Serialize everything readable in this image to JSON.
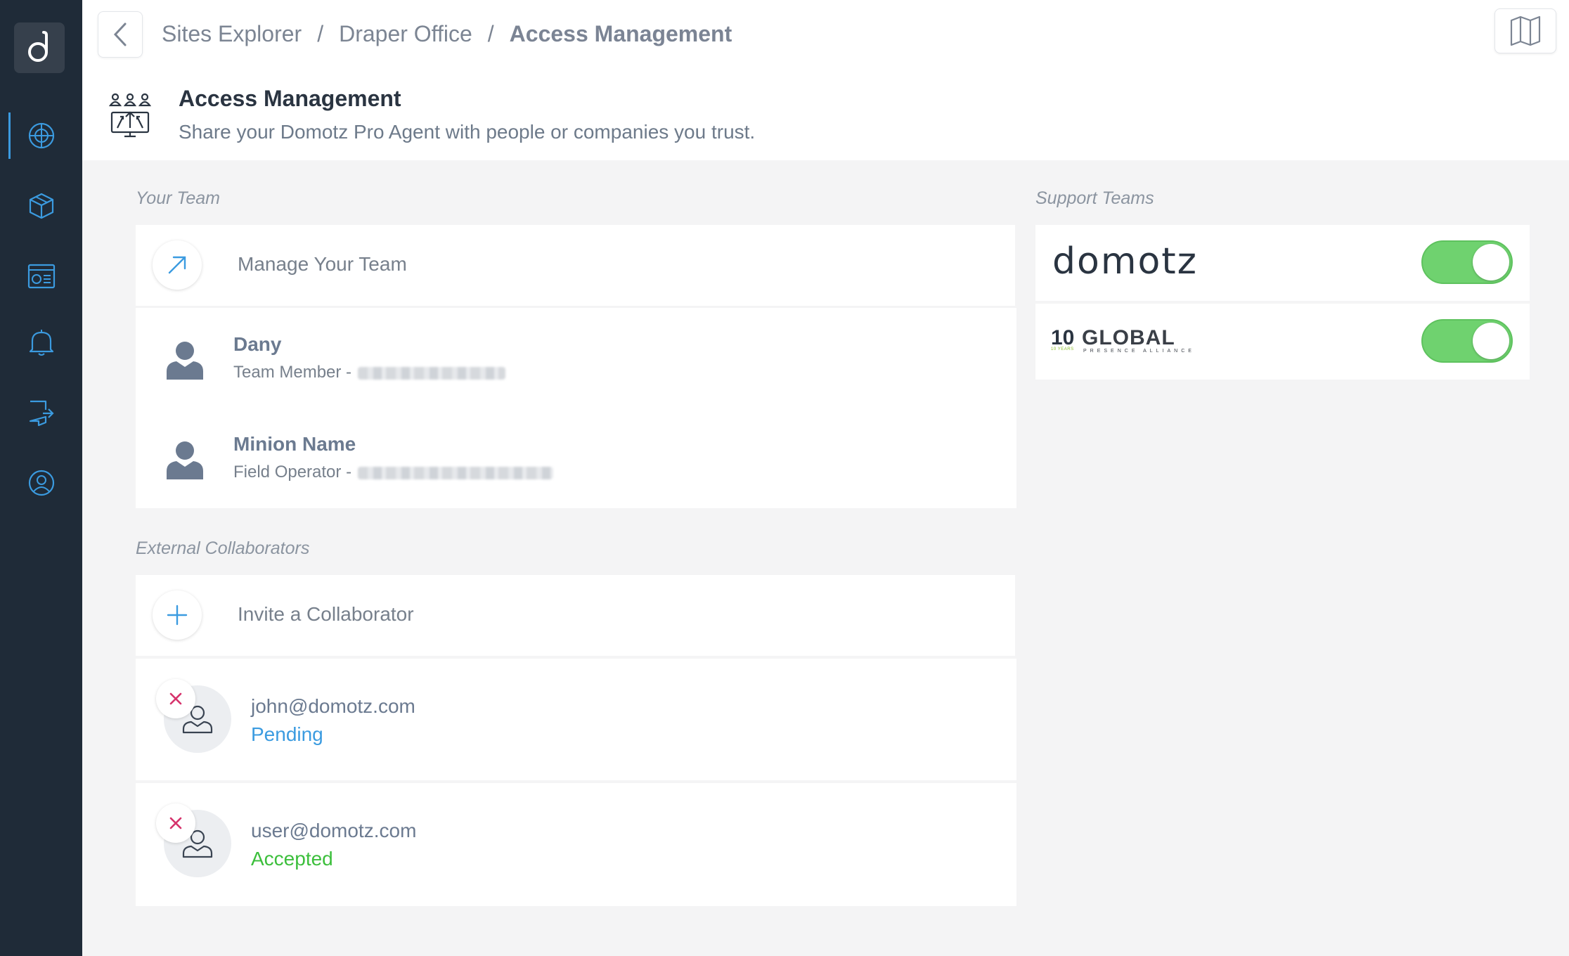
{
  "sidebar": {
    "logo": "domotz-logo",
    "items": [
      {
        "icon": "globe-icon",
        "active": true
      },
      {
        "icon": "cube-icon",
        "active": false
      },
      {
        "icon": "dashboard-icon",
        "active": false
      },
      {
        "icon": "bell-icon",
        "active": false
      },
      {
        "icon": "integration-icon",
        "active": false
      },
      {
        "icon": "support-icon",
        "active": false
      }
    ]
  },
  "header": {
    "breadcrumb": [
      "Sites Explorer",
      "Draper Office",
      "Access Management"
    ],
    "separator": "/",
    "title": "Access Management",
    "subtitle": "Share your Domotz Pro Agent with people or companies you trust."
  },
  "your_team": {
    "label": "Your Team",
    "manage_label": "Manage Your Team",
    "members": [
      {
        "name": "Dany",
        "role": "Team Member -"
      },
      {
        "name": "Minion Name",
        "role": "Field Operator -"
      }
    ]
  },
  "external": {
    "label": "External Collaborators",
    "invite_label": "Invite a Collaborator",
    "collaborators": [
      {
        "email": "john@domotz.com",
        "status": "Pending",
        "status_color": "#3b9be0"
      },
      {
        "email": "user@domotz.com",
        "status": "Accepted",
        "status_color": "#3cbf3c"
      }
    ]
  },
  "support": {
    "label": "Support Teams",
    "teams": [
      {
        "logo_text": "domotz",
        "enabled": true
      },
      {
        "logo_text": "GLOBAL",
        "logo_prefix": "10",
        "logo_small": "10 YEARS",
        "logo_tagline": "PRESENCE ALLIANCE",
        "enabled": true
      }
    ]
  },
  "colors": {
    "sidebar": "#1f2b38",
    "accent": "#3b9be0",
    "toggle_on": "#6fd26f",
    "remove": "#d6336c"
  }
}
